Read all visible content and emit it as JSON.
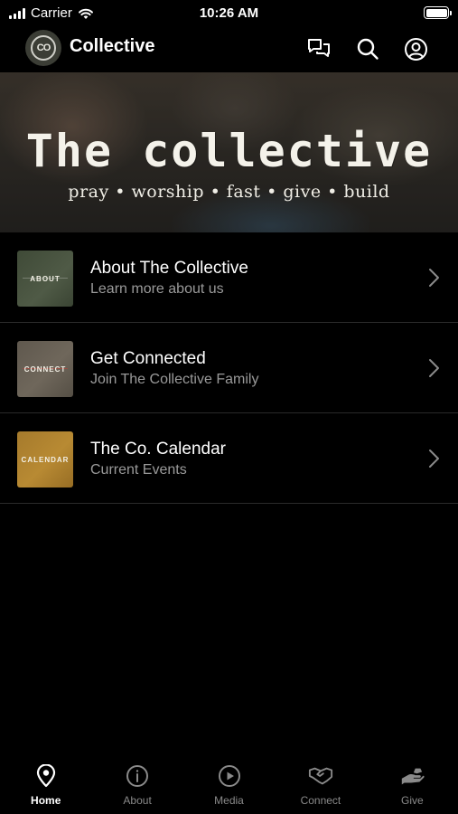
{
  "status_bar": {
    "carrier": "Carrier",
    "time": "10:26 AM"
  },
  "header": {
    "logo_text": "CO",
    "title": "Collective"
  },
  "hero": {
    "title": "The collective",
    "subtitle": "pray • worship • fast • give • build"
  },
  "menu": {
    "items": [
      {
        "thumb_label": "ABOUT",
        "title": "About The Collective",
        "subtitle": "Learn more about us"
      },
      {
        "thumb_label": "CONNECT",
        "title": "Get Connected",
        "subtitle": "Join The Collective Family"
      },
      {
        "thumb_label": "CALENDAR",
        "title": "The Co. Calendar",
        "subtitle": "Current Events"
      }
    ]
  },
  "tab_bar": {
    "tabs": [
      {
        "label": "Home",
        "icon": "location-pin-icon",
        "active": true
      },
      {
        "label": "About",
        "icon": "info-icon",
        "active": false
      },
      {
        "label": "Media",
        "icon": "play-icon",
        "active": false
      },
      {
        "label": "Connect",
        "icon": "handshake-icon",
        "active": false
      },
      {
        "label": "Give",
        "icon": "giving-hand-icon",
        "active": false
      }
    ]
  },
  "colors": {
    "background": "#000000",
    "text_primary": "#ffffff",
    "text_secondary": "#9a9a9a",
    "tab_inactive": "#8a8a8a"
  }
}
